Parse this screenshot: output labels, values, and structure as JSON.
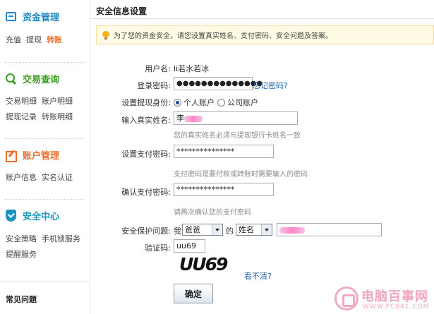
{
  "sidebar": {
    "sections": [
      {
        "title": "资金管理",
        "icon": "wallet-icon",
        "color": "#1e86c5",
        "links": [
          "充值",
          "提现",
          "转账"
        ],
        "active_link": "转账"
      },
      {
        "title": "交易查询",
        "icon": "search-icon",
        "color": "#3a9e1e",
        "links": [
          "交易明细",
          "账户明细",
          "提现记录",
          "转账明细"
        ]
      },
      {
        "title": "账户管理",
        "icon": "edit-icon",
        "color": "#e8702a",
        "links": [
          "账户信息",
          "实名认证"
        ]
      },
      {
        "title": "安全中心",
        "icon": "shield-icon",
        "color": "#1c95be",
        "links": [
          "安全策略",
          "手机锁服务",
          "提醒服务"
        ]
      }
    ],
    "faq": "常见问题"
  },
  "page_title": "安全信息设置",
  "notice": "为了您的资金安全，请您设置真实姓名、支付密码、安全问题及答案。",
  "form": {
    "username_label": "用户名:",
    "username_value": "li若水若冰",
    "login_pwd_label": "登录密码:",
    "login_pwd_value": "●●●●●●●●●●●●●●",
    "forgot_pwd": "忘记密码?",
    "identity_label": "设置提现身份:",
    "identity_personal": "个人账户",
    "identity_company": "公司账户",
    "realname_label": "输入真实姓名:",
    "realname_value": "李",
    "realname_hint": "您的真实姓名必须与提现银行卡姓名一致",
    "paypwd_label": "设置支付密码:",
    "paypwd_value": "***************",
    "paypwd_hint": "支付密码是要付款或转账时需要输入的密码",
    "confirm_label": "确认支付密码:",
    "confirm_value": "***************",
    "confirm_hint": "请再次确认您的支付密码",
    "question_label": "安全保护问题:",
    "question_prefix": "我",
    "question_rel": "爸爸",
    "question_de": "的",
    "question_attr": "姓名",
    "verify_label": "验证码:",
    "verify_value": "uu69",
    "captcha_text": "UU69",
    "refresh_captcha": "看不清?",
    "submit": "确定"
  },
  "watermark": {
    "name": "电脑百事网",
    "url": "WWW.PC841.COM"
  }
}
